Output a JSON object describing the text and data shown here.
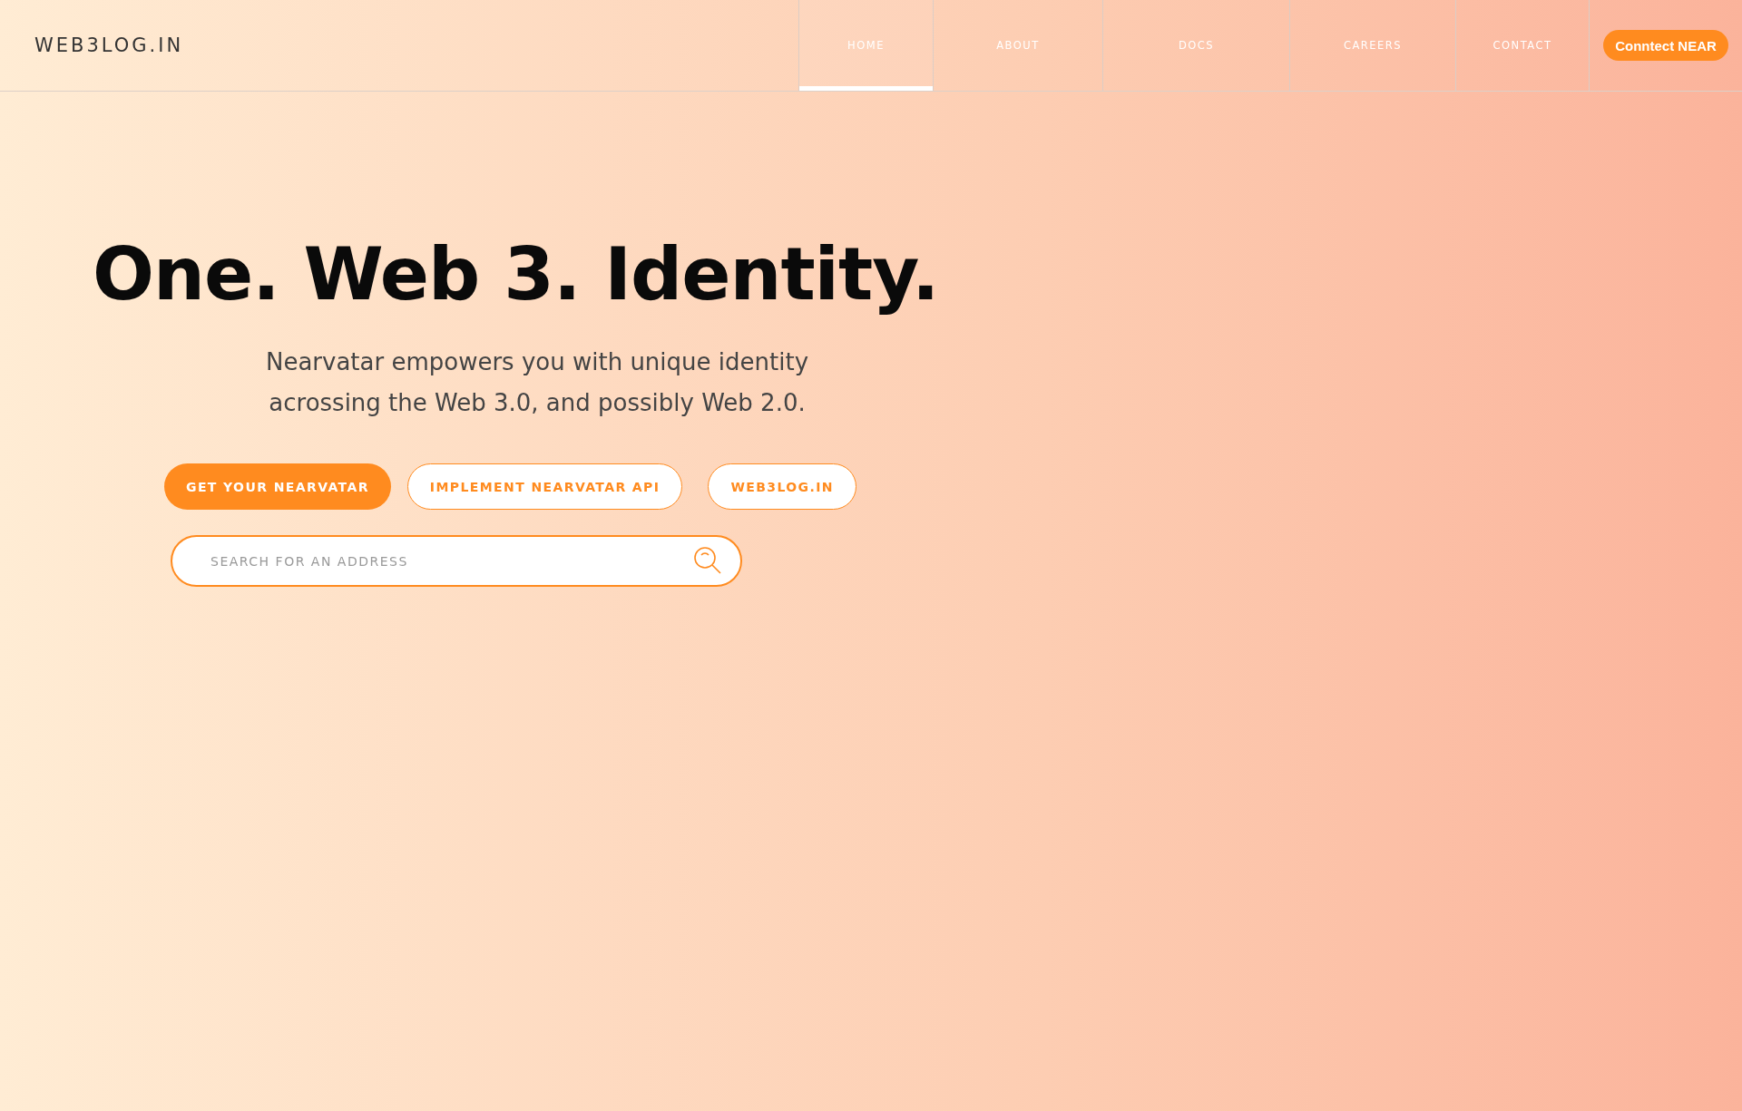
{
  "logo": "WEB3LOG.IN",
  "nav": [
    {
      "label": "HOME",
      "selected": true
    },
    {
      "label": "ABOUT",
      "selected": false
    },
    {
      "label": "DOCS",
      "selected": false
    },
    {
      "label": "CAREERS",
      "selected": false
    },
    {
      "label": "CONTACT",
      "selected": false
    }
  ],
  "connect_button": "Conntect NEAR",
  "hero": {
    "title": "One. Web 3. Identity.",
    "subtitle": "Nearvatar empowers you with unique identity acrossing the Web 3.0, and possibly Web 2.0."
  },
  "actions": [
    {
      "label": "GET YOUR NEARVATAR",
      "kind": "primary"
    },
    {
      "label": "IMPLEMENT NEARVATAR API",
      "kind": "outline"
    },
    {
      "label": "WEB3LOG.IN",
      "kind": "outline"
    }
  ],
  "search": {
    "placeholder": "SEARCH FOR AN ADDRESS"
  }
}
